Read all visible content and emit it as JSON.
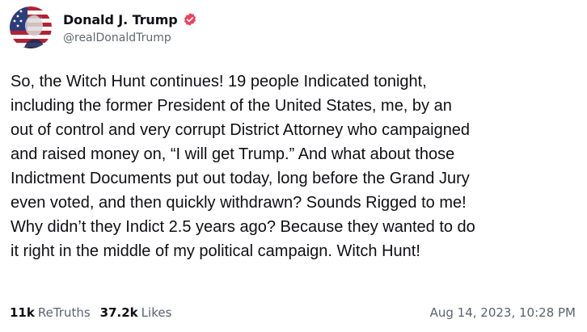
{
  "author": {
    "display_name": "Donald J. Trump",
    "handle": "@realDonaldTrump",
    "verified_badge_icon": "verified-badge-icon",
    "avatar_icon": "profile-avatar",
    "verified_color": "#e8455e"
  },
  "post": {
    "lines": [
      "So, the Witch Hunt continues! 19 people Indicated tonight,",
      "including the former President of the United States, me, by an",
      "out of control and very corrupt District Attorney who campaigned",
      "and raised money on, “I will get Trump.” And what about those",
      "Indictment Documents put out today, long before the Grand Jury",
      "even voted, and then quickly withdrawn? Sounds Rigged to me!",
      "Why didn’t they Indict 2.5 years ago? Because they wanted to do",
      "it right in the middle of my political campaign. Witch Hunt!"
    ]
  },
  "stats": {
    "retruths_count": "11k",
    "retruths_label": "ReTruths",
    "likes_count": "37.2k",
    "likes_label": "Likes"
  },
  "timestamp": "Aug 14, 2023, 10:28 PM"
}
